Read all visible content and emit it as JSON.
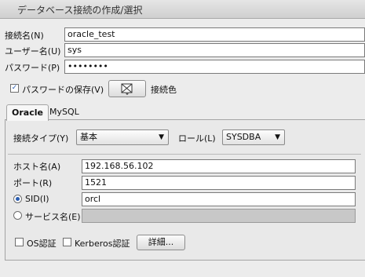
{
  "window": {
    "title": "データベース接続の作成/選択"
  },
  "form": {
    "connection_name_label": "接続名(N)",
    "connection_name_value": "oracle_test",
    "user_label": "ユーザー名(U)",
    "user_value": "sys",
    "password_label": "パスワード(P)",
    "password_value": "••••••••",
    "save_password_label": "パスワードの保存(V)",
    "save_password_checked": true,
    "connection_color_label": "接続色"
  },
  "tabs": [
    {
      "label": "Oracle",
      "active": true
    },
    {
      "label": "MySQL",
      "active": false
    }
  ],
  "oracle": {
    "connection_type_label": "接続タイプ(Y)",
    "connection_type_value": "基本",
    "role_label": "ロール(L)",
    "role_value": "SYSDBA",
    "host_label": "ホスト名(A)",
    "host_value": "192.168.56.102",
    "port_label": "ポート(R)",
    "port_value": "1521",
    "sid_label": "SID(I)",
    "sid_value": "orcl",
    "sid_selected": true,
    "service_label": "サービス名(E)",
    "service_value": "",
    "os_auth_label": "OS認証",
    "kerberos_label": "Kerberos認証",
    "details_button": "詳細..."
  },
  "colors": {
    "checkbox_accent": "#2a5db0",
    "radio_accent": "#2a5db0"
  }
}
